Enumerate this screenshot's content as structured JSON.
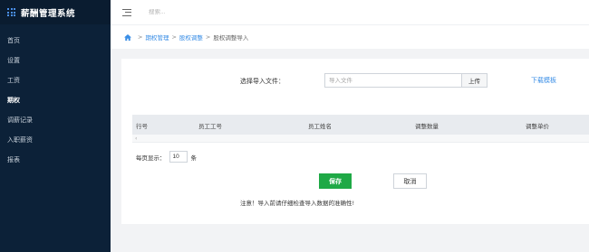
{
  "app": {
    "title": "薪酬管理系统"
  },
  "sidebar": {
    "items": [
      {
        "label": "首页",
        "active": false
      },
      {
        "label": "设置",
        "active": false
      },
      {
        "label": "工资",
        "active": false
      },
      {
        "label": "期权",
        "active": true
      },
      {
        "label": "调薪记录",
        "active": false
      },
      {
        "label": "入职薪资",
        "active": false
      },
      {
        "label": "报表",
        "active": false
      }
    ]
  },
  "topbar": {
    "search_placeholder": "搜索..."
  },
  "breadcrumb": {
    "items": [
      "期权管理",
      "股权调整"
    ],
    "current": "股权调整导入",
    "separator": ">"
  },
  "upload": {
    "label": "选择导入文件：",
    "placeholder": "导入文件",
    "upload_button": "上传",
    "download_template": "下载模板"
  },
  "table": {
    "columns": [
      "行号",
      "员工工号",
      "员工姓名",
      "调整数量",
      "调整单价"
    ],
    "scroll_left": "‹"
  },
  "pager": {
    "prefix": "每页显示：",
    "page_size": "10",
    "suffix": "条"
  },
  "actions": {
    "save": "保存",
    "cancel": "取消"
  },
  "notice": "注意！导入前请仔细检查导入数据的准确性!",
  "colors": {
    "sidebar_bg": "#0c2138",
    "accent": "#3a8ee6",
    "save": "#1fa946"
  }
}
